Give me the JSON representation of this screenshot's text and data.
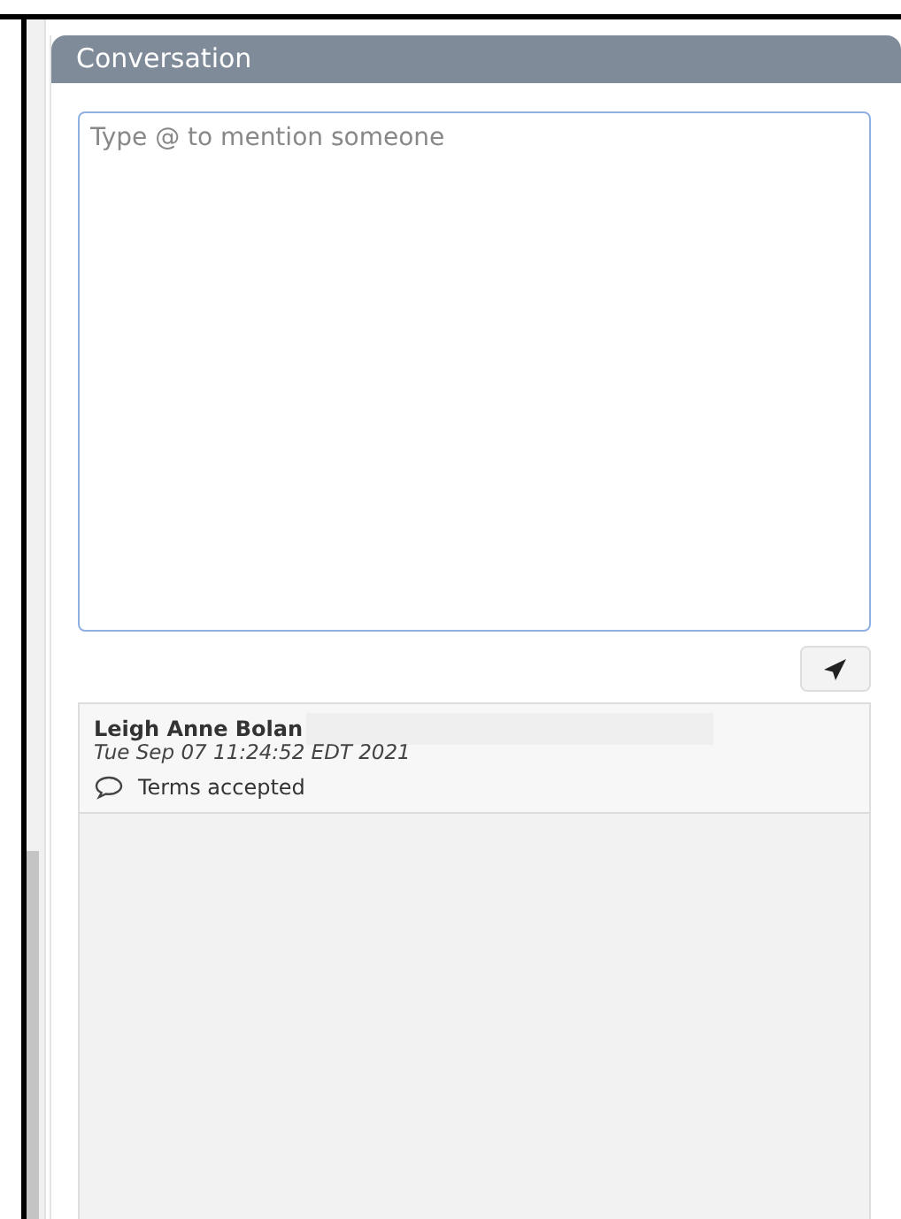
{
  "panel": {
    "title": "Conversation"
  },
  "composer": {
    "placeholder": "Type @ to mention someone"
  },
  "comments": [
    {
      "author": "Leigh Anne Bolan",
      "timestamp": "Tue Sep 07 11:24:52 EDT 2021",
      "text": "Terms accepted"
    }
  ]
}
